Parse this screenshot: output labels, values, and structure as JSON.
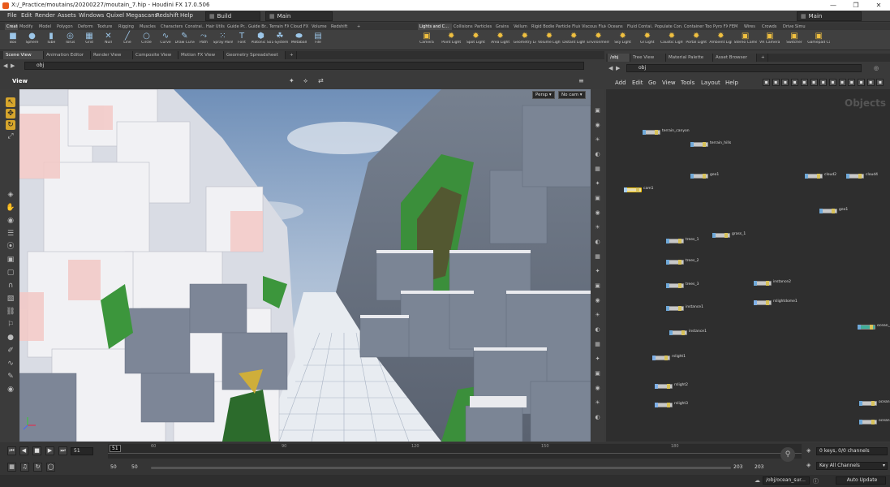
{
  "window": {
    "title": "X:/_Practice/moutains/20200227/moutain_7.hip - Houdini FX 17.0.506",
    "controls": [
      "—",
      "❐",
      "✕"
    ]
  },
  "menubar": {
    "items": [
      "File",
      "Edit",
      "Render",
      "Assets",
      "Windows",
      "Quixel Megascans",
      "Redshift",
      "Help"
    ],
    "desktop": "Build",
    "main": "Main",
    "right_main": "Main"
  },
  "shelf_tabs_left": [
    "Create",
    "Modify",
    "Model",
    "Polygon",
    "Deform",
    "Texture",
    "Rigging",
    "Muscles",
    "Characters",
    "Constrai...",
    "Hair Utils",
    "Guide Pr...",
    "Guide Br...",
    "Terrain FX",
    "Cloud FX",
    "Volume",
    "Redshift"
  ],
  "shelf_tabs_right": [
    "Lights and C...",
    "Collisions",
    "Particles",
    "Grains",
    "Vellum",
    "Rigid Bodies",
    "Particle Fluids",
    "Viscous Fluids",
    "Oceans",
    "Fluid Contai...",
    "Populate Con...",
    "Container Tools",
    "Pyro FX",
    "FEM",
    "Wires",
    "Crowds",
    "Drive Simula..."
  ],
  "shelf_tools_left": [
    {
      "label": "Box",
      "icon": "box-icon",
      "glyph": "■"
    },
    {
      "label": "Sphere",
      "icon": "sphere-icon",
      "glyph": "●"
    },
    {
      "label": "Tube",
      "icon": "tube-icon",
      "glyph": "▮"
    },
    {
      "label": "Torus",
      "icon": "torus-icon",
      "glyph": "◎"
    },
    {
      "label": "Grid",
      "icon": "grid-icon",
      "glyph": "▦"
    },
    {
      "label": "Null",
      "icon": "null-icon",
      "glyph": "✕"
    },
    {
      "label": "Line",
      "icon": "line-icon",
      "glyph": "╱"
    },
    {
      "label": "Circle",
      "icon": "circle-icon",
      "glyph": "○"
    },
    {
      "label": "Curve",
      "icon": "curve-icon",
      "glyph": "∿"
    },
    {
      "label": "Draw Curve",
      "icon": "draw-curve-icon",
      "glyph": "✎"
    },
    {
      "label": "Path",
      "icon": "path-icon",
      "glyph": "⤳"
    },
    {
      "label": "Spray Paint",
      "icon": "spray-paint-icon",
      "glyph": "⁙"
    },
    {
      "label": "Font",
      "icon": "font-icon",
      "glyph": "T"
    },
    {
      "label": "Platonic Solids",
      "icon": "platonic-solids-icon",
      "glyph": "⬢"
    },
    {
      "label": "L-System",
      "icon": "l-system-icon",
      "glyph": "☘"
    },
    {
      "label": "Metaball",
      "icon": "metaball-icon",
      "glyph": "⬬"
    },
    {
      "label": "File",
      "icon": "file-icon",
      "glyph": "▤"
    }
  ],
  "shelf_tools_right": [
    {
      "label": "Camera",
      "icon": "camera-icon",
      "glyph": "▣"
    },
    {
      "label": "Point Light",
      "icon": "point-light-icon",
      "glyph": "✹"
    },
    {
      "label": "Spot Light",
      "icon": "spot-light-icon",
      "glyph": "✹"
    },
    {
      "label": "Area Light",
      "icon": "area-light-icon",
      "glyph": "✹"
    },
    {
      "label": "Geometry Light",
      "icon": "geometry-light-icon",
      "glyph": "✹"
    },
    {
      "label": "Volume Light",
      "icon": "volume-light-icon",
      "glyph": "✹"
    },
    {
      "label": "Distant Light",
      "icon": "distant-light-icon",
      "glyph": "✹"
    },
    {
      "label": "Environment Light",
      "icon": "environment-light-icon",
      "glyph": "✹"
    },
    {
      "label": "Sky Light",
      "icon": "sky-light-icon",
      "glyph": "✹"
    },
    {
      "label": "GI Light",
      "icon": "gi-light-icon",
      "glyph": "✹"
    },
    {
      "label": "Caustic Light",
      "icon": "caustic-light-icon",
      "glyph": "✹"
    },
    {
      "label": "Portal Light",
      "icon": "portal-light-icon",
      "glyph": "✹"
    },
    {
      "label": "Ambient Light",
      "icon": "ambient-light-icon",
      "glyph": "✹"
    },
    {
      "label": "Stereo Camera",
      "icon": "stereo-camera-icon",
      "glyph": "▣"
    },
    {
      "label": "VR Camera",
      "icon": "vr-camera-icon",
      "glyph": "▣"
    },
    {
      "label": "Switcher",
      "icon": "switcher-icon",
      "glyph": "▣"
    },
    {
      "label": "Gamepad Camera",
      "icon": "gamepad-camera-icon",
      "glyph": "▣"
    }
  ],
  "pane_tabs_left": [
    "Scene View",
    "Animation Editor",
    "Render View",
    "Composite View",
    "Motion FX View",
    "Geometry Spreadsheet"
  ],
  "pane_tabs_right": [
    "/obj",
    "Tree View",
    "Material Palette",
    "Asset Browser"
  ],
  "viewer": {
    "path": "obj",
    "label": "View",
    "persp": "Persp",
    "cam": "No cam"
  },
  "network": {
    "path": "obj",
    "menu": [
      "Add",
      "Edit",
      "Go",
      "View",
      "Tools",
      "Layout",
      "Help"
    ],
    "context_label": "Objects",
    "nodes": [
      {
        "name": "terrain_canyon",
        "kind": "geo"
      },
      {
        "name": "terrain_hills",
        "kind": "geo"
      },
      {
        "name": "geo1",
        "kind": "geo"
      },
      {
        "name": "cloud2",
        "kind": "geo"
      },
      {
        "name": "cloud4",
        "kind": "geo"
      },
      {
        "name": "cam1",
        "kind": "cam",
        "selected": true
      },
      {
        "name": "geo1",
        "kind": "geo"
      },
      {
        "name": "grass_1",
        "kind": "geo"
      },
      {
        "name": "trees_1",
        "kind": "geo"
      },
      {
        "name": "trees_2",
        "kind": "geo"
      },
      {
        "name": "trees_3",
        "kind": "geo"
      },
      {
        "name": "instance2",
        "kind": "geo"
      },
      {
        "name": "instance1",
        "kind": "geo"
      },
      {
        "name": "rslightdome1",
        "kind": "light"
      },
      {
        "name": "instance1",
        "kind": "geo"
      },
      {
        "name": "ocean_s",
        "kind": "ocean"
      },
      {
        "name": "rslight1",
        "kind": "light"
      },
      {
        "name": "rslight2",
        "kind": "light"
      },
      {
        "name": "rslight3",
        "kind": "light"
      },
      {
        "name": "ocean",
        "kind": "geo"
      },
      {
        "name": "ocean",
        "kind": "geo"
      }
    ]
  },
  "timeline": {
    "current_frame": "51",
    "frame_marker": "51",
    "ticks": [
      "60",
      "90",
      "120",
      "150",
      "180"
    ],
    "range_start": "50",
    "range_start2": "50",
    "range_end": "203",
    "range_end2": "203"
  },
  "keys_panel": {
    "keys_info": "0 keys, 0/0 channels",
    "key_all": "Key All Channels"
  },
  "status": {
    "path": "/obj/ocean_sur...",
    "auto_update": "Auto Update"
  }
}
